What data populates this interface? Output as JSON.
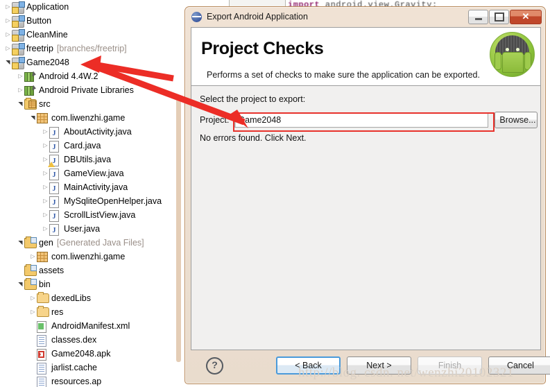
{
  "background": {
    "code_line": "import android.view.Gravity;",
    "code_keyword": "import",
    "code_identifier": "android.view.Gravity;"
  },
  "tree": {
    "name": "package-explorer",
    "items": [
      {
        "label": "Application",
        "suffix": "",
        "indent": 0,
        "twisty": "collapsed",
        "icon": "android-project-icon"
      },
      {
        "label": "Button",
        "suffix": "",
        "indent": 0,
        "twisty": "collapsed",
        "icon": "android-project-icon"
      },
      {
        "label": "CleanMine",
        "suffix": "",
        "indent": 0,
        "twisty": "collapsed",
        "icon": "android-project-icon"
      },
      {
        "label": "freetrip",
        "suffix": "[branches/freetrip]",
        "indent": 0,
        "twisty": "collapsed",
        "icon": "android-project-icon"
      },
      {
        "label": "Game2048",
        "suffix": "",
        "indent": 0,
        "twisty": "expanded",
        "icon": "android-project-icon"
      },
      {
        "label": "Android 4.4W.2",
        "suffix": "",
        "indent": 1,
        "twisty": "collapsed",
        "icon": "library-icon"
      },
      {
        "label": "Android Private Libraries",
        "suffix": "",
        "indent": 1,
        "twisty": "collapsed",
        "icon": "library-icon"
      },
      {
        "label": "src",
        "suffix": "",
        "indent": 1,
        "twisty": "expanded",
        "icon": "source-folder-icon"
      },
      {
        "label": "com.liwenzhi.game",
        "suffix": "",
        "indent": 2,
        "twisty": "expanded",
        "icon": "package-icon"
      },
      {
        "label": "AboutActivity.java",
        "suffix": "",
        "indent": 3,
        "twisty": "collapsed",
        "icon": "java-file-icon"
      },
      {
        "label": "Card.java",
        "suffix": "",
        "indent": 3,
        "twisty": "collapsed",
        "icon": "java-file-icon"
      },
      {
        "label": "DBUtils.java",
        "suffix": "",
        "indent": 3,
        "twisty": "collapsed",
        "icon": "java-file-warning-icon"
      },
      {
        "label": "GameView.java",
        "suffix": "",
        "indent": 3,
        "twisty": "collapsed",
        "icon": "java-file-icon"
      },
      {
        "label": "MainActivity.java",
        "suffix": "",
        "indent": 3,
        "twisty": "collapsed",
        "icon": "java-file-icon"
      },
      {
        "label": "MySqliteOpenHelper.java",
        "suffix": "",
        "indent": 3,
        "twisty": "collapsed",
        "icon": "java-file-icon"
      },
      {
        "label": "ScrollListView.java",
        "suffix": "",
        "indent": 3,
        "twisty": "collapsed",
        "icon": "java-file-icon"
      },
      {
        "label": "User.java",
        "suffix": "",
        "indent": 3,
        "twisty": "collapsed",
        "icon": "java-file-icon"
      },
      {
        "label": "gen",
        "suffix": "[Generated Java Files]",
        "indent": 1,
        "twisty": "expanded",
        "icon": "gen-folder-icon"
      },
      {
        "label": "com.liwenzhi.game",
        "suffix": "",
        "indent": 2,
        "twisty": "collapsed",
        "icon": "package-icon"
      },
      {
        "label": "assets",
        "suffix": "",
        "indent": 1,
        "twisty": "none",
        "icon": "gen-folder-icon"
      },
      {
        "label": "bin",
        "suffix": "",
        "indent": 1,
        "twisty": "expanded",
        "icon": "gen-folder-icon"
      },
      {
        "label": "dexedLibs",
        "suffix": "",
        "indent": 2,
        "twisty": "collapsed",
        "icon": "folder-icon"
      },
      {
        "label": "res",
        "suffix": "",
        "indent": 2,
        "twisty": "collapsed",
        "icon": "folder-icon"
      },
      {
        "label": "AndroidManifest.xml",
        "suffix": "",
        "indent": 2,
        "twisty": "none",
        "icon": "xml-file-icon"
      },
      {
        "label": "classes.dex",
        "suffix": "",
        "indent": 2,
        "twisty": "none",
        "icon": "generic-file-icon"
      },
      {
        "label": "Game2048.apk",
        "suffix": "",
        "indent": 2,
        "twisty": "none",
        "icon": "apk-file-icon"
      },
      {
        "label": "jarlist.cache",
        "suffix": "",
        "indent": 2,
        "twisty": "none",
        "icon": "generic-file-icon"
      },
      {
        "label": "resources.ap",
        "suffix": "",
        "indent": 2,
        "twisty": "none",
        "icon": "generic-file-icon"
      }
    ]
  },
  "dialog": {
    "window_title": "Export Android Application",
    "window_buttons": {
      "minimize": "minimize-button",
      "maximize": "maximize-button",
      "close": "✕"
    },
    "page_title": "Project Checks",
    "page_subtitle": "Performs a set of checks to make sure the application can be exported.",
    "select_label": "Select the project to export:",
    "project_label": "Project:",
    "project_value": "Game2048",
    "project_placeholder": "",
    "browse_label": "Browse...",
    "status_message": "No errors found. Click Next.",
    "help_label": "?",
    "buttons": [
      {
        "label": "< Back",
        "state": "focused"
      },
      {
        "label": "Next >",
        "state": "enabled"
      },
      {
        "label": "Finish",
        "state": "disabled"
      },
      {
        "label": "Cancel",
        "state": "enabled"
      }
    ]
  },
  "annotations": {
    "arrow_color": "#ec2d26",
    "highlight_color": "#e8312b",
    "watermark": "http://blog. csdn. net/wenzhi20102321"
  }
}
